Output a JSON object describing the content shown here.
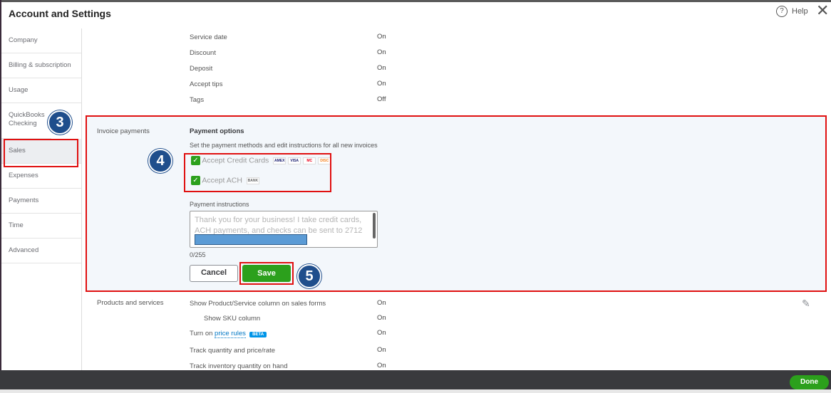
{
  "header": {
    "title": "Account and Settings",
    "help": "Help",
    "help_icon": "?",
    "close_icon": "✕"
  },
  "sidebar": {
    "items": [
      "Company",
      "Billing & subscription",
      "Usage",
      "QuickBooks Checking",
      "Sales",
      "Expenses",
      "Payments",
      "Time",
      "Advanced"
    ]
  },
  "top_rows": [
    {
      "label": "Service date",
      "value": "On"
    },
    {
      "label": "Discount",
      "value": "On"
    },
    {
      "label": "Deposit",
      "value": "On"
    },
    {
      "label": "Accept tips",
      "value": "On"
    },
    {
      "label": "Tags",
      "value": "Off"
    }
  ],
  "invoice_payments": {
    "section_label": "Invoice payments",
    "heading": "Payment options",
    "description": "Set the payment methods and edit instructions for all new invoices",
    "credit_cards": "Accept Credit Cards",
    "ach": "Accept ACH",
    "card_logos": [
      "AMEX",
      "VISA",
      "MC",
      "DISC"
    ],
    "ach_logo": "BANK",
    "instructions_label": "Payment instructions",
    "instructions_text": "Thank you for your business! I take credit cards, ACH payments, and checks can be sent to 2712",
    "char_count": "0/255",
    "cancel": "Cancel",
    "save": "Save",
    "checkmark": "✓"
  },
  "products": {
    "section_label": "Products and services",
    "rows": [
      {
        "label": "Show Product/Service column on sales forms",
        "value": "On"
      },
      {
        "label": "Show SKU column",
        "value": "On"
      },
      {
        "label": "Turn on",
        "link": "price rules",
        "badge": "BETA",
        "value": "On"
      },
      {
        "label": "Track quantity and price/rate",
        "value": "On"
      },
      {
        "label": "Track inventory quantity on hand",
        "value": "On"
      }
    ],
    "edit_icon": "✎"
  },
  "annotations": [
    "3",
    "4",
    "5"
  ],
  "footer": {
    "done": "Done"
  }
}
